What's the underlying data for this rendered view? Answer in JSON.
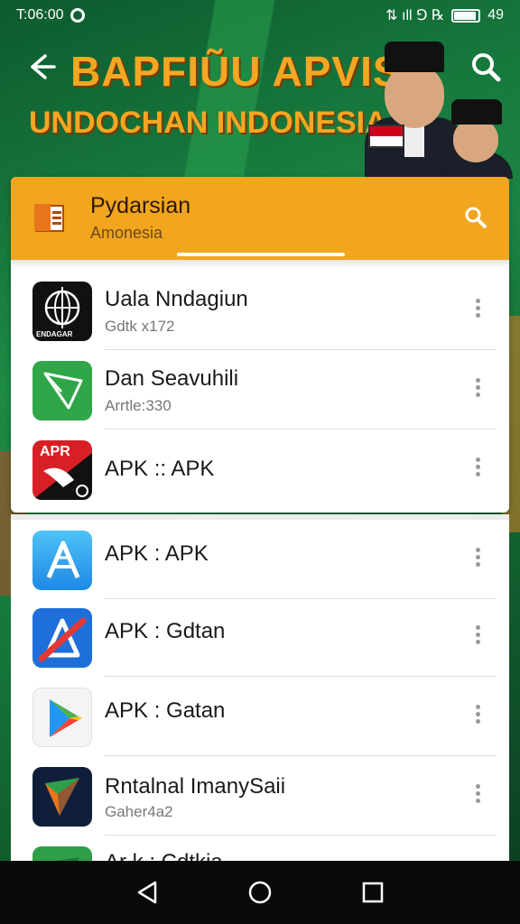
{
  "status_bar": {
    "time": "T:06:00",
    "network": "⇅ ıll ⅁ ℞",
    "battery_level": "49",
    "battery_fraction": 0.85
  },
  "banner": {
    "title": "BAPFIŨU APVIS",
    "subtitle": "UNDOCHAN INDONESIA"
  },
  "card": {
    "title": "Pydarsian",
    "subtitle": "Amonesia"
  },
  "apps": [
    {
      "title": "Uala Nndagiun",
      "meta": "Gdtk x172",
      "icon": "globe-icon",
      "icon_caption": "ENDAGAR"
    },
    {
      "title": "Dan Seavuhili",
      "meta": "Arrtle:330",
      "icon": "paper-plane-icon"
    },
    {
      "title": "APK :: APK",
      "meta": "",
      "icon": "pen-nib-icon",
      "icon_caption": "APR"
    },
    {
      "title": "APK : APK",
      "meta": "",
      "icon": "app-store-icon"
    },
    {
      "title": "APK : Gdtan",
      "meta": "",
      "icon": "blocked-store-icon"
    },
    {
      "title": "APK : Gatan",
      "meta": "",
      "icon": "play-store-icon"
    },
    {
      "title": "Rntalnal ImanySaii",
      "meta": "Gaher4a2",
      "icon": "kite-icon"
    },
    {
      "title": "Ar k : Cdtkia",
      "meta": "",
      "icon": "kite-icon"
    }
  ],
  "colors": {
    "accent": "#f2a51f",
    "banner_bg": "#1d8a45",
    "nav_bg": "#0a0a0a"
  }
}
